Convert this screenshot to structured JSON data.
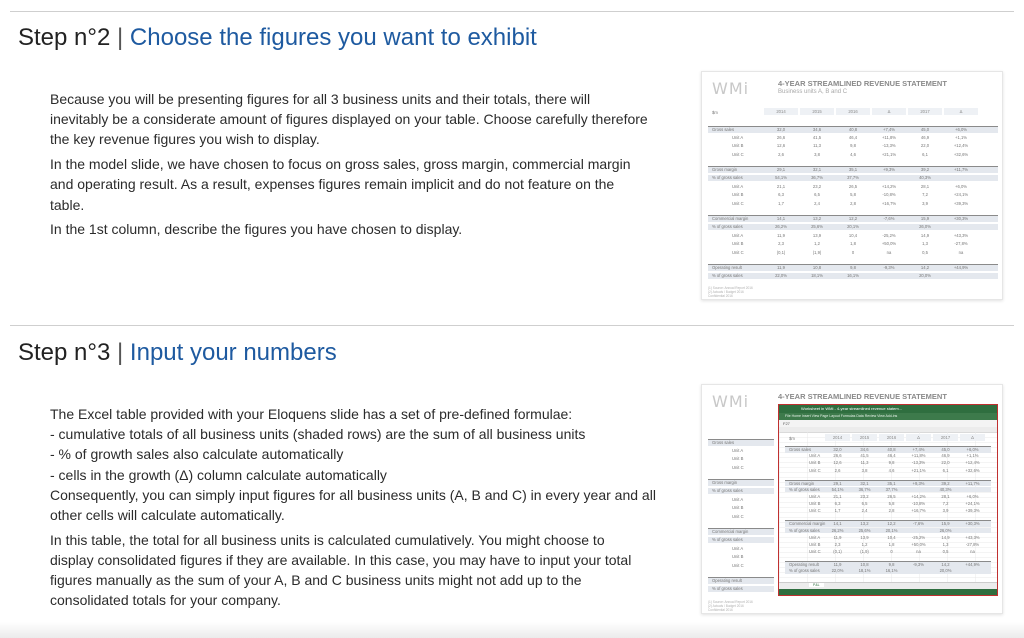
{
  "step2": {
    "number": "Step n°2",
    "separator": "|",
    "title": "Choose the figures you want to exhibit",
    "paragraphs": [
      [
        "Because you will be presenting figures for all 3 business units and their totals, there will",
        "inevitably be a considerate amount of figures displayed on your table. Choose carefully therefore",
        "the key revenue figures you wish to display."
      ],
      [
        "In the model slide, we have chosen to focus on gross sales, gross margin, commercial margin",
        "and operating result. As a result, expenses figures remain implicit and do not feature on the",
        "table."
      ],
      [
        "In the 1st column, describe the figures you have chosen to display."
      ]
    ]
  },
  "step3": {
    "number": "Step n°3",
    "separator": "|",
    "title": "Input your numbers",
    "paragraphs": [
      [
        "The Excel table provided with your Eloquens slide has a set of pre-defined formulae:",
        "- cumulative totals of all business units (shaded rows) are the sum of all business units",
        "- % of growth sales also calculate automatically",
        "- cells in the growth (Δ) column calculate automatically",
        "Consequently, you can simply input figures for all business units (A, B and C) in every year and all",
        "other cells will calculate automatically."
      ],
      [
        "In this table, the total for all business units is calculated cumulatively. You might choose to",
        "display consolidated figures if they are available. In this case, you may have to input your total",
        "figures manually as the sum of your A, B and C business units might not add up to the",
        "consolidated totals for your company."
      ]
    ]
  },
  "slide": {
    "logo": "WMi",
    "title": "4-YEAR STREAMLINED REVENUE STATEMENT",
    "subtitle": "Business units A, B and C",
    "corner": "$m",
    "years": [
      "2014",
      "2015",
      "2016",
      "Δ",
      "2017",
      "Δ"
    ],
    "rows": [
      {
        "label": "Gross sales",
        "indent": false,
        "shade": true,
        "border": true,
        "values": [
          "32,0",
          "34,6",
          "40,8",
          "+7,4%",
          "45,0",
          "+6,0%"
        ]
      },
      {
        "label": "Unit A",
        "indent": true,
        "shade": false,
        "border": false,
        "values": [
          "26,6",
          "41,5",
          "46,4",
          "+11,8%",
          "46,9",
          "+1,1%"
        ]
      },
      {
        "label": "Unit B",
        "indent": true,
        "shade": false,
        "border": false,
        "values": [
          "12,6",
          "11,3",
          "9,8",
          "-13,3%",
          "22,0",
          "+12,4%"
        ]
      },
      {
        "label": "Unit C",
        "indent": true,
        "shade": false,
        "border": false,
        "values": [
          "2,6",
          "3,8",
          "4,6",
          "+21,1%",
          "6,1",
          "+32,6%"
        ]
      },
      {
        "label": "Gross margin",
        "indent": false,
        "shade": true,
        "border": true,
        "values": [
          "29,1",
          "32,1",
          "35,1",
          "+9,3%",
          "39,2",
          "+11,7%"
        ]
      },
      {
        "label": "% of gross sales",
        "indent": false,
        "shade": true,
        "border": false,
        "values": [
          "54,1%",
          "36,7%",
          "37,7%",
          "",
          "40,3%",
          ""
        ]
      },
      {
        "label": "Unit A",
        "indent": true,
        "shade": false,
        "border": false,
        "values": [
          "21,1",
          "23,2",
          "26,5",
          "+14,2%",
          "28,1",
          "+6,0%"
        ]
      },
      {
        "label": "Unit B",
        "indent": true,
        "shade": false,
        "border": false,
        "values": [
          "6,3",
          "6,5",
          "5,8",
          "-10,8%",
          "7,2",
          "+24,1%"
        ]
      },
      {
        "label": "Unit C",
        "indent": true,
        "shade": false,
        "border": false,
        "values": [
          "1,7",
          "2,4",
          "2,8",
          "+16,7%",
          "3,9",
          "+39,3%"
        ]
      },
      {
        "label": "Commercial margin",
        "indent": false,
        "shade": true,
        "border": true,
        "values": [
          "14,1",
          "13,2",
          "12,2",
          "-7,6%",
          "15,9",
          "+30,3%"
        ]
      },
      {
        "label": "% of gross sales",
        "indent": false,
        "shade": true,
        "border": false,
        "values": [
          "26,2%",
          "25,6%",
          "20,1%",
          "",
          "26,0%",
          ""
        ]
      },
      {
        "label": "Unit A",
        "indent": true,
        "shade": false,
        "border": false,
        "values": [
          "11,9",
          "13,9",
          "10,4",
          "-25,2%",
          "14,9",
          "+43,3%"
        ]
      },
      {
        "label": "Unit B",
        "indent": true,
        "shade": false,
        "border": false,
        "values": [
          "2,3",
          "1,2",
          "1,8",
          "+50,0%",
          "1,3",
          "-27,8%"
        ]
      },
      {
        "label": "Unit C",
        "indent": true,
        "shade": false,
        "border": false,
        "values": [
          "(0,1)",
          "(1,9)",
          "0",
          "na",
          "0,5",
          "na"
        ]
      },
      {
        "label": "Operating result",
        "indent": false,
        "shade": true,
        "border": true,
        "values": [
          "11,9",
          "10,8",
          "9,8",
          "-9,3%",
          "14,2",
          "+44,9%"
        ]
      },
      {
        "label": "% of gross sales",
        "indent": false,
        "shade": true,
        "border": false,
        "values": [
          "22,0%",
          "18,1%",
          "16,1%",
          "",
          "20,0%",
          ""
        ]
      }
    ],
    "footnote": "(1) Source: Annual Report 2016\n(2) Actuals / Budget 2016\nConfidential 2016",
    "excel_title": "Worksheet in WMi - 4-year streamlined revenue statem...",
    "excel_ribbon": "File   Home   Insert   View   Page Layout   Formulas   Data   Review   View   Add-ins",
    "excel_cell": "F27",
    "excel_tab": "P&L"
  }
}
